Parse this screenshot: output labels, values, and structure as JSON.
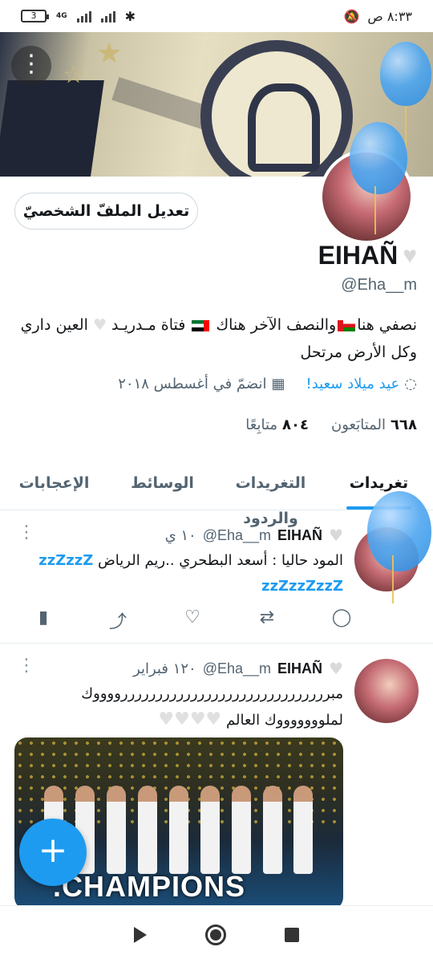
{
  "status_bar": {
    "battery": "3",
    "network": "4G",
    "time": "٨:٣٣ ص"
  },
  "profile": {
    "edit_button": "تعديل الملفّ الشخصيّ",
    "name": "EIHAÑ",
    "handle": "@Eha__m",
    "bio_part1": "نصفي هنا",
    "bio_part2": "والنصف الآخر هناك",
    "bio_part3": "فتاة مـدريـد",
    "bio_part4": "العين داري وكل الأرض مرتحل",
    "birthday": "عيد ميلاد سعيد!",
    "joined": "انضمّ في أغسطس ٢٠١٨",
    "followers_count": "٦٦٨",
    "followers_label": "المتابَعون",
    "following_count": "٨٠٤",
    "following_label": "متابِعًا"
  },
  "tabs": [
    {
      "label": "تغريدات"
    },
    {
      "label": "التغريدات والردود"
    },
    {
      "label": "الوسائط"
    },
    {
      "label": "الإعجابات"
    }
  ],
  "tweets": [
    {
      "name": "EIHAÑ",
      "handle": "@Eha__m",
      "time": "١٠ ي",
      "text_line1": "المود حاليا : أسعد البطحري ..ريم الرياض",
      "zz1": "zzZzzZ",
      "zz2": "zzZzzZzzZ"
    },
    {
      "name": "EIHAÑ",
      "handle": "@Eha__m",
      "time": "١٢٠ فبراير",
      "text_line1": "مبررررررررررررررررررررررررررررررووووك",
      "text_line2": "لملوووووووك العالم",
      "media_caption": ".CHAMPIONS"
    }
  ],
  "fab": {
    "label": "+"
  },
  "icons": {
    "more": "more-vertical-icon",
    "location": "location-icon",
    "calendar": "calendar-icon",
    "reply": "reply-icon",
    "retweet": "retweet-icon",
    "like": "like-icon",
    "share": "share-icon",
    "analytics": "analytics-icon"
  },
  "colors": {
    "accent": "#1d9bf0",
    "secondary_text": "#536471"
  }
}
